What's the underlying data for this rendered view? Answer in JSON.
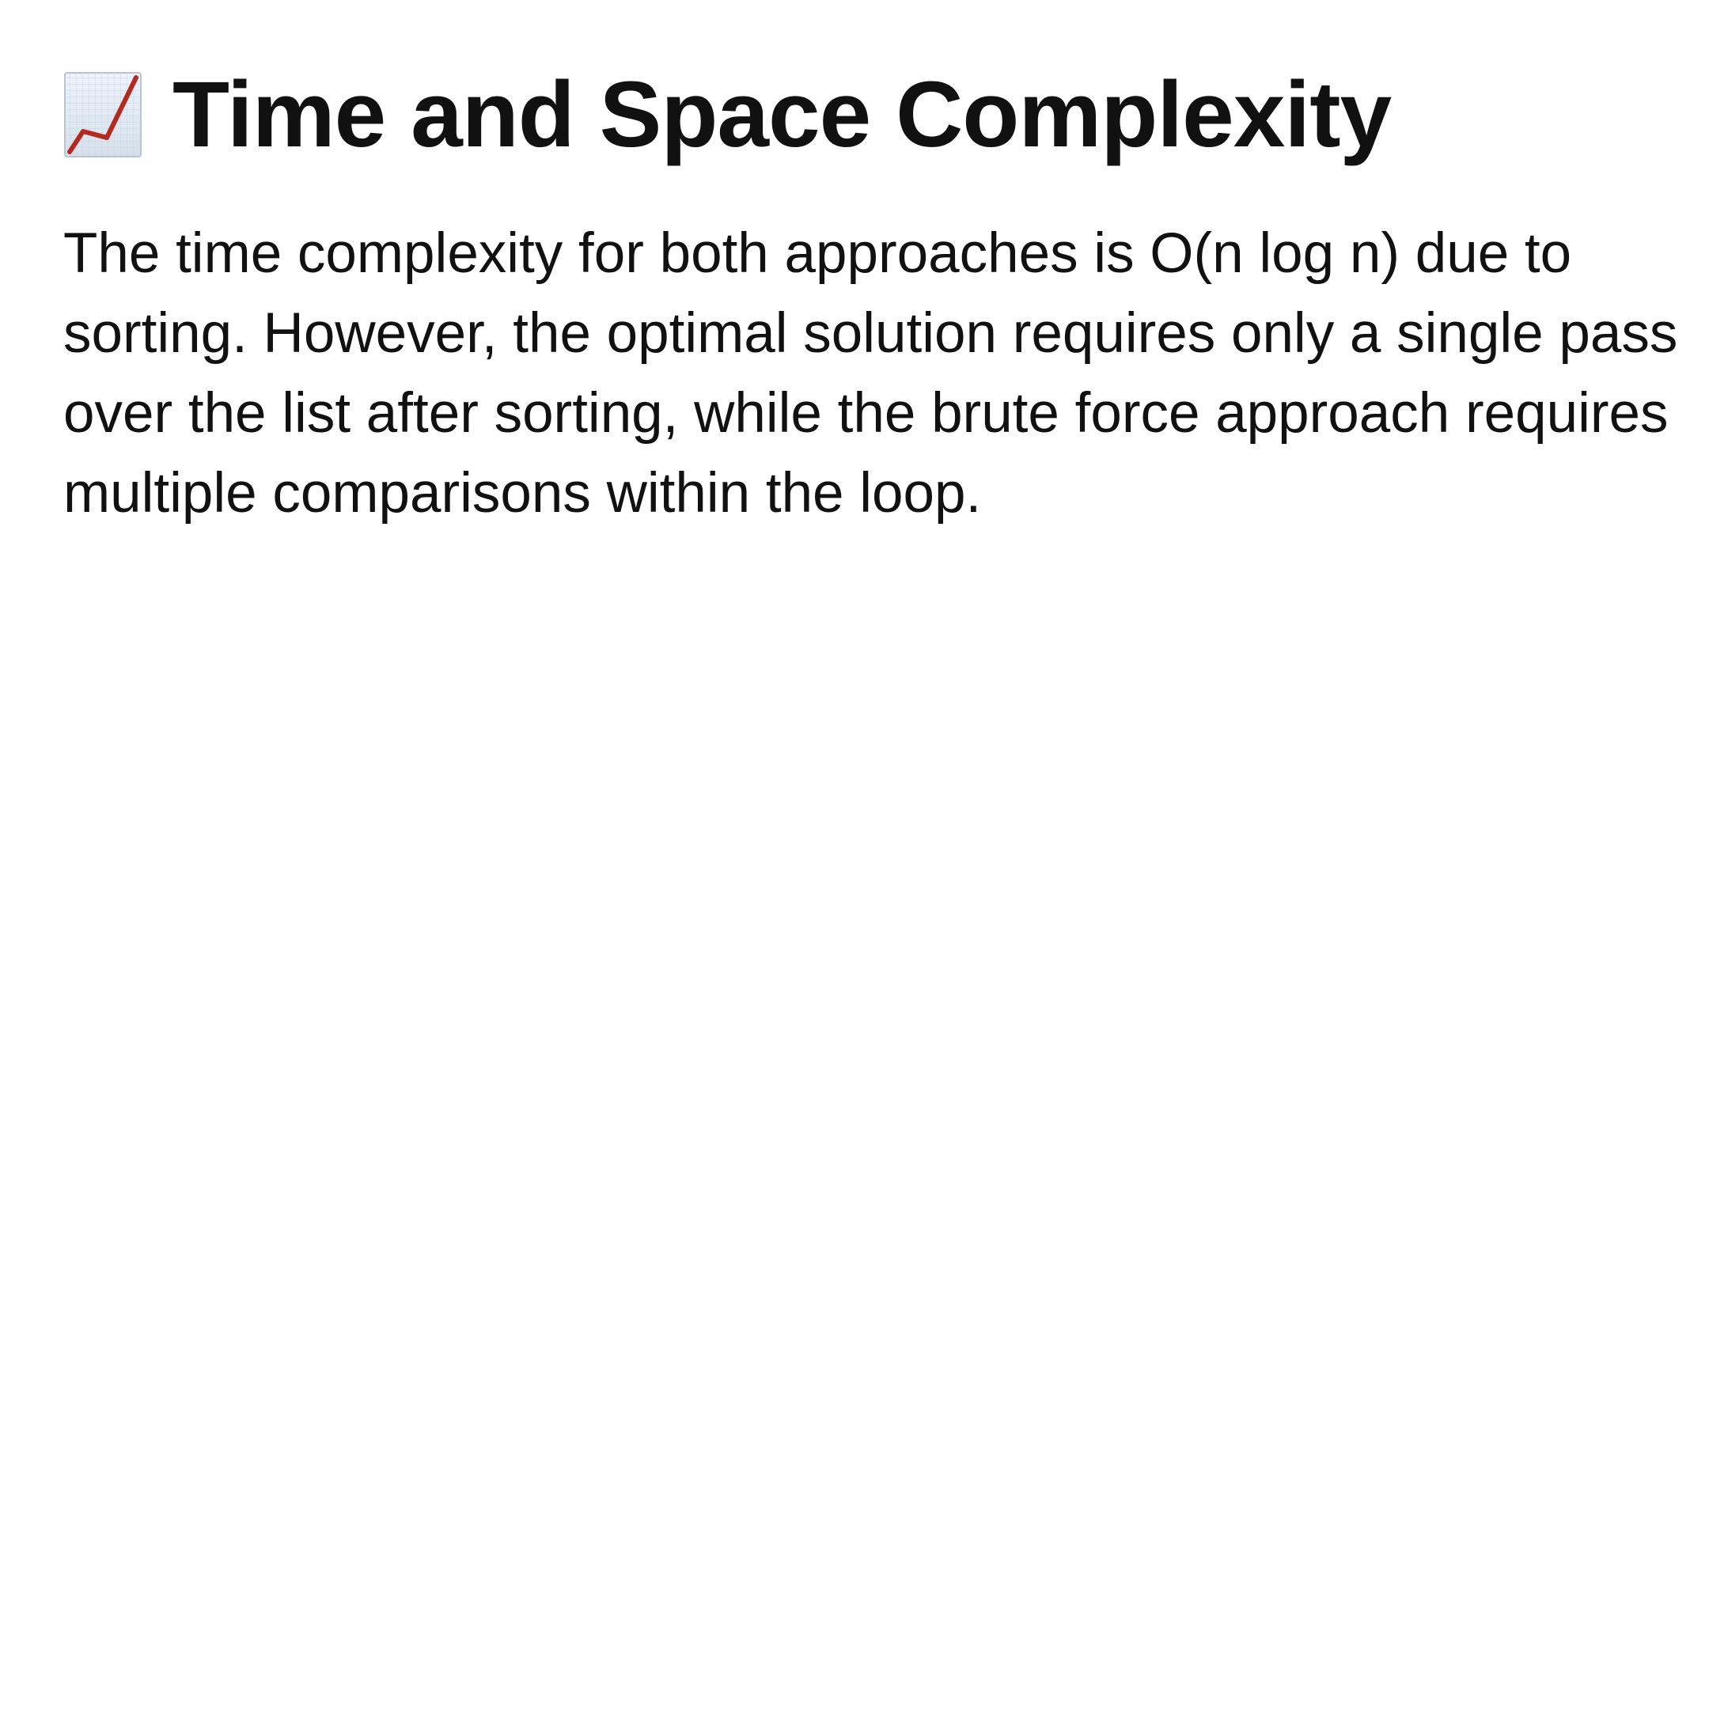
{
  "heading": {
    "icon": "chart-increasing-icon",
    "title": "Time and Space Complexity"
  },
  "paragraph": {
    "text": "The time complexity for both approaches is O(n log n) due to sorting. However, the optimal solution requires only a single pass over the list after sorting, while the brute force approach requires multiple comparisons within the loop."
  },
  "colors": {
    "text": "#111111",
    "background": "#ffffff",
    "chart_line": "#b22a20",
    "chart_grid": "#c9d6e6"
  }
}
